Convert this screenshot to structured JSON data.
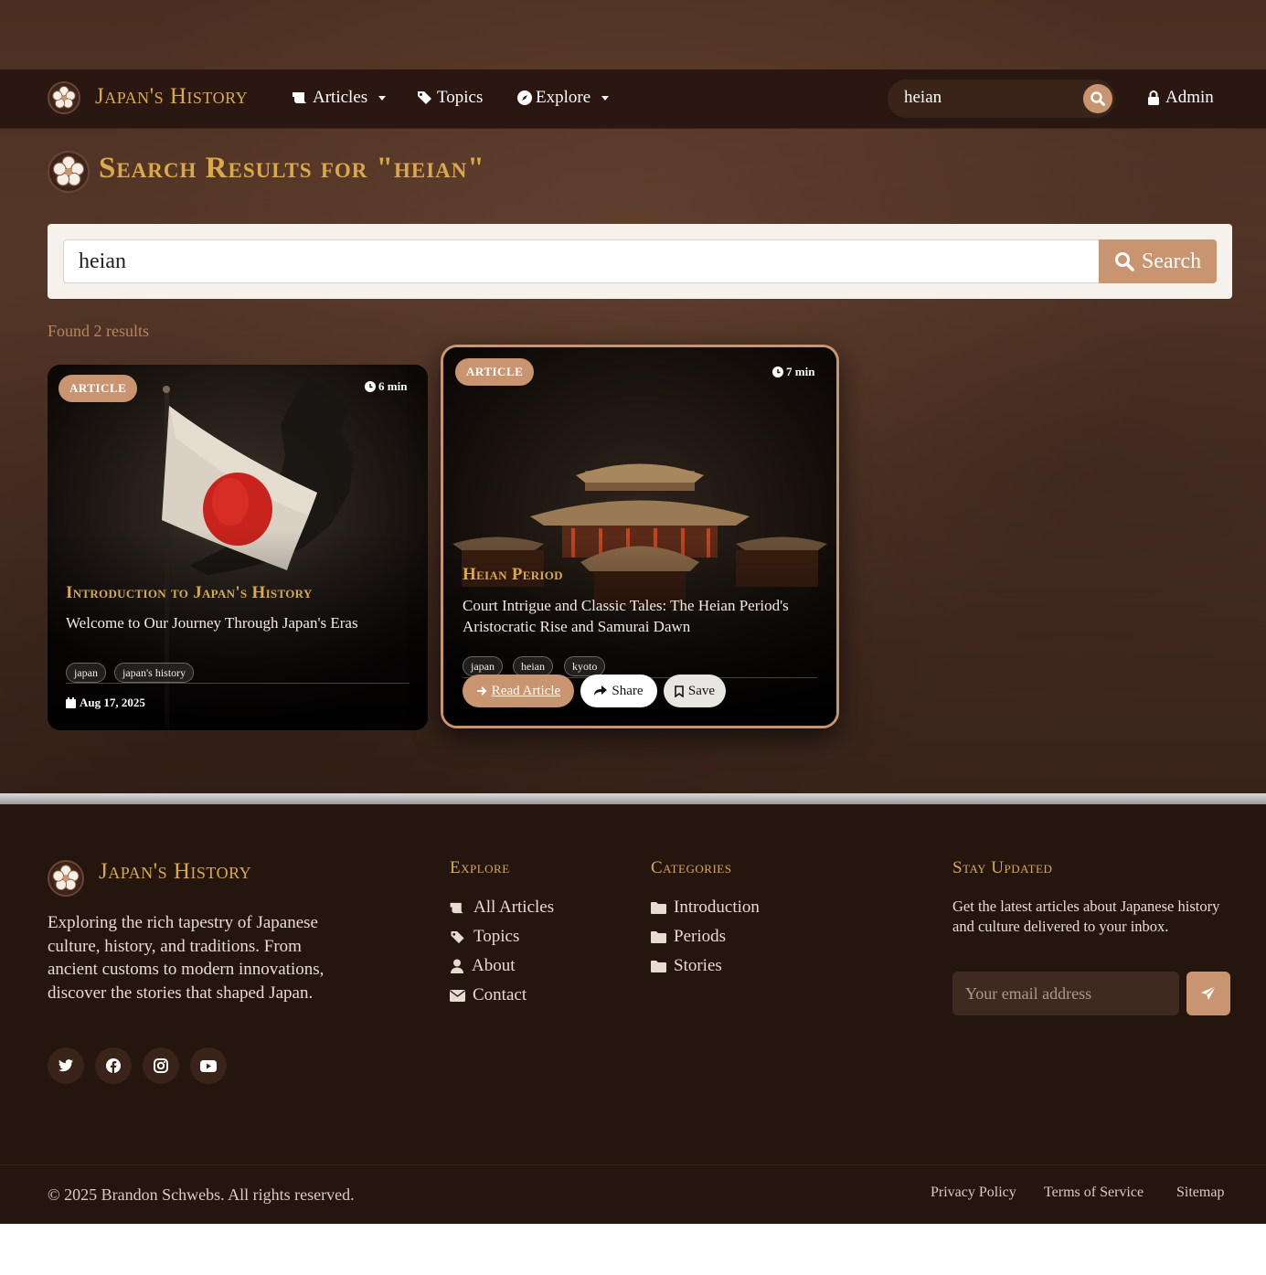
{
  "brand": {
    "name": "Japan's History",
    "logo_icon": "sakura-crest-icon"
  },
  "nav": {
    "items": [
      {
        "label": "Articles",
        "icon": "scroll-icon",
        "dropdown": true
      },
      {
        "label": "Topics",
        "icon": "tags-icon",
        "dropdown": false
      },
      {
        "label": "Explore",
        "icon": "compass-icon",
        "dropdown": true
      }
    ],
    "search_value": "heian",
    "admin_label": "Admin"
  },
  "page": {
    "title": "Search Results for \"heian\"",
    "search_value": "heian",
    "search_button": "Search",
    "results_count": "Found 2 results"
  },
  "results": [
    {
      "badge": "ARTICLE",
      "read_time": "6 min",
      "title": "Introduction to Japan's History",
      "subtitle": "Welcome to Our Journey Through Japan's Eras",
      "tags": [
        "japan",
        "japan's history"
      ],
      "date": "Aug 17, 2025"
    },
    {
      "badge": "ARTICLE",
      "read_time": "7 min",
      "title": "Heian Period",
      "subtitle": "Court Intrigue and Classic Tales: The Heian Period's Aristocratic Rise and Samurai Dawn",
      "tags": [
        "japan",
        "heian",
        "kyoto"
      ],
      "actions": {
        "read": "Read Article",
        "share": "Share",
        "save": "Save"
      }
    }
  ],
  "footer": {
    "brand": "Japan's History",
    "description": "Exploring the rich tapestry of Japanese culture, history, and traditions. From ancient customs to modern innovations, discover the stories that shaped Japan.",
    "social": [
      "twitter-icon",
      "facebook-icon",
      "instagram-icon",
      "youtube-icon"
    ],
    "explore": {
      "heading": "Explore",
      "links": [
        "All Articles",
        "Topics",
        "About",
        "Contact"
      ]
    },
    "categories": {
      "heading": "Categories",
      "links": [
        "Introduction",
        "Periods",
        "Stories"
      ]
    },
    "newsletter": {
      "heading": "Stay Updated",
      "text": "Get the latest articles about Japanese history and culture delivered to your inbox.",
      "placeholder": "Your email address"
    },
    "copyright": "© 2025 Brandon Schwebs. All rights reserved.",
    "legal": [
      "Privacy Policy",
      "Terms of Service",
      "Sitemap"
    ]
  },
  "colors": {
    "accent": "#c99570",
    "gold": "#d9a94a",
    "dark": "#24150f"
  }
}
